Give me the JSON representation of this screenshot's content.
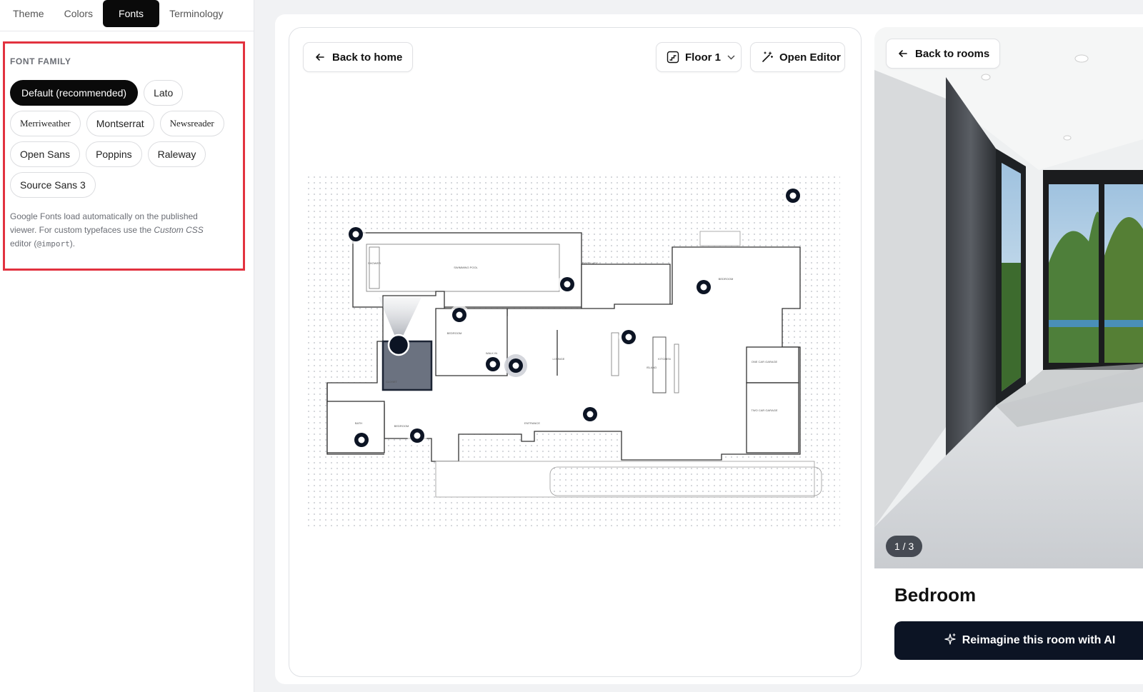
{
  "left_panel": {
    "tabs": [
      {
        "label": "Theme",
        "active": false
      },
      {
        "label": "Colors",
        "active": false
      },
      {
        "label": "Fonts",
        "active": true
      },
      {
        "label": "Terminology",
        "active": false
      }
    ],
    "section_label": "FONT FAMILY",
    "fonts": [
      {
        "label": "Default (recommended)",
        "selected": true
      },
      {
        "label": "Lato",
        "selected": false
      },
      {
        "label": "Merriweather",
        "selected": false
      },
      {
        "label": "Montserrat",
        "selected": false
      },
      {
        "label": "Newsreader",
        "selected": false
      },
      {
        "label": "Open Sans",
        "selected": false
      },
      {
        "label": "Poppins",
        "selected": false
      },
      {
        "label": "Raleway",
        "selected": false
      },
      {
        "label": "Source Sans 3",
        "selected": false
      }
    ],
    "helper": {
      "part1": "Google Fonts load automatically on the published viewer. For custom typefaces use the ",
      "em": "Custom CSS",
      "part2": " editor (",
      "code": "@import",
      "part3": ")."
    }
  },
  "viewer": {
    "back_home_label": "Back to home",
    "floor_label": "Floor 1",
    "open_editor_label": "Open Editor",
    "plan_labels": {
      "swimming_pool": "SWIMMING POOL",
      "fireplace": "FIREPLACE",
      "bedroom": "BEDROOM",
      "lounge": "LOUNGE",
      "kitchen": "KITCHEN",
      "island": "ISLAND",
      "closet": "CLOSET",
      "bath": "BATH",
      "entrance": "ENTRANCE",
      "one_car_garage": "ONE CAR GARAGE",
      "two_car_garage": "TWO CAR GARAGE",
      "shower": "SHOWER",
      "walk_in": "WALK IN",
      "powder": "POWDER"
    }
  },
  "room": {
    "back_rooms_label": "Back to rooms",
    "counter": "1 / 3",
    "title": "Bedroom",
    "reimagine_label": "Reimagine this room with AI"
  },
  "colors": {
    "accent_dark": "#0c1424",
    "highlight_border": "#e2323f",
    "selected_room": "#6b7280"
  },
  "icons": {
    "back_home": "arrow-left-icon",
    "floor": "stairs-icon",
    "floor_chevron": "chevron-down-icon",
    "editor": "wand-icon",
    "back_rooms": "arrow-left-icon",
    "reimagine": "sparkles-icon"
  }
}
